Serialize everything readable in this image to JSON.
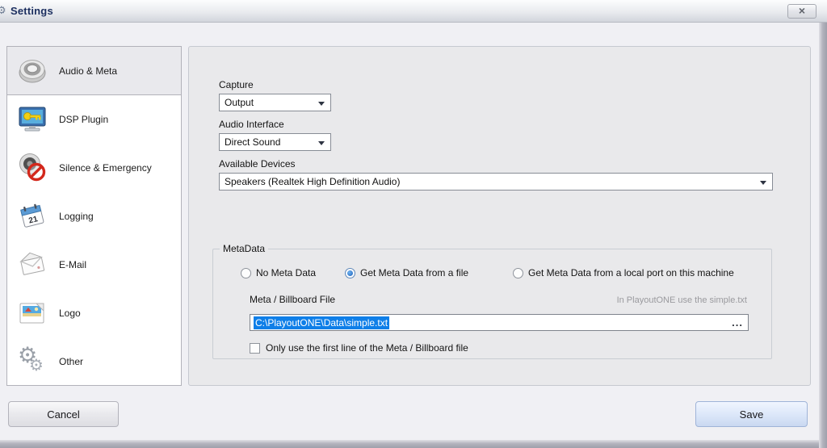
{
  "window": {
    "title": "Settings",
    "close_label": "×",
    "app_icon": "⚙"
  },
  "sidebar": {
    "items": [
      {
        "label": "Audio & Meta",
        "icon": "speaker-icon",
        "selected": true
      },
      {
        "label": "DSP Plugin",
        "icon": "dsp-monitor-icon",
        "selected": false
      },
      {
        "label": "Silence & Emergency",
        "icon": "muted-speaker-icon",
        "selected": false
      },
      {
        "label": "Logging",
        "icon": "calendar-icon",
        "selected": false
      },
      {
        "label": "E-Mail",
        "icon": "envelope-icon",
        "selected": false
      },
      {
        "label": "Logo",
        "icon": "picture-icon",
        "selected": false
      },
      {
        "label": "Other",
        "icon": "gears-icon",
        "selected": false
      }
    ],
    "calendar_day": "21",
    "gear_glyph": "⚙"
  },
  "main": {
    "capture": {
      "label": "Capture",
      "value": "Output"
    },
    "audio_interface": {
      "label": "Audio Interface",
      "value": "Direct Sound"
    },
    "available_devices": {
      "label": "Available Devices",
      "value": "Speakers (Realtek High Definition Audio)"
    },
    "metadata": {
      "legend": "MetaData",
      "options": [
        {
          "label": "No Meta Data",
          "selected": false
        },
        {
          "label": "Get Meta Data from a file",
          "selected": true
        },
        {
          "label": "Get Meta Data from a local port on this machine",
          "selected": false
        }
      ],
      "file": {
        "label": "Meta / Billboard File",
        "hint": "In PlayoutONE use the simple.txt",
        "value": "C:\\PlayoutONE\\Data\\simple.txt",
        "browse_label": "...",
        "text_selected": true
      },
      "first_line_checkbox": {
        "label": "Only use the first line of the Meta / Billboard file",
        "checked": false
      }
    }
  },
  "footer": {
    "cancel_label": "Cancel",
    "save_label": "Save"
  },
  "colors": {
    "selection_blue": "#0f7fe8",
    "title_text": "#1b2e5f",
    "panel_bg": "#e9e9eb",
    "sidebar_bg": "#ffffff",
    "save_button_border": "#9fb4d8"
  }
}
